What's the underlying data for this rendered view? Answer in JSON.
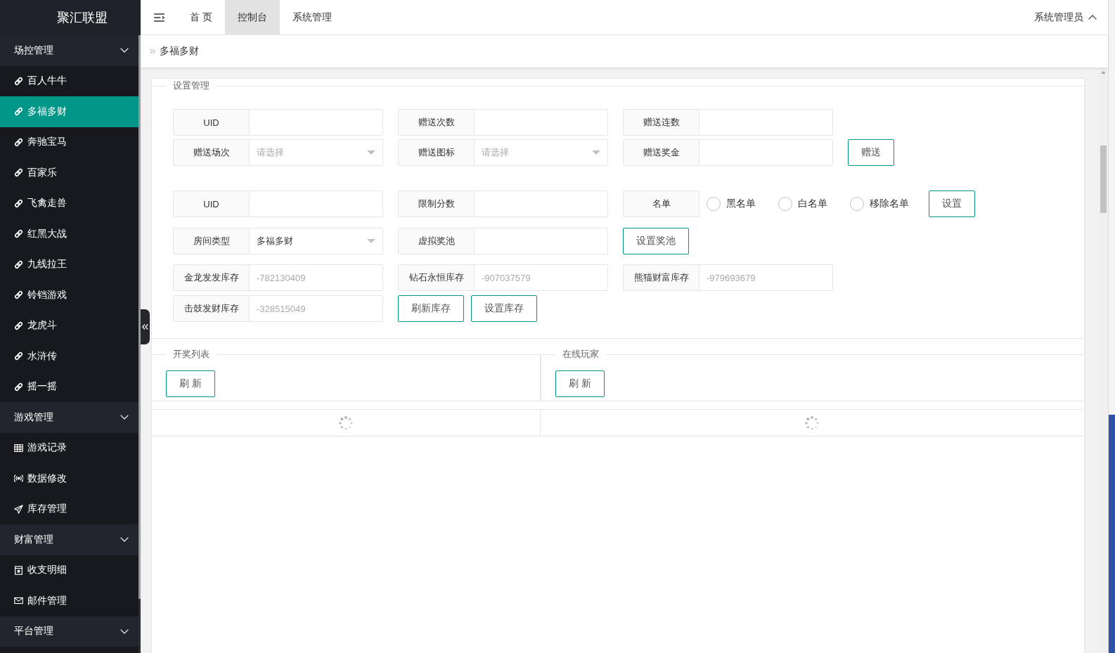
{
  "sidebar": {
    "logo": "聚汇联盟",
    "groups": [
      {
        "title": "场控管理",
        "items": [
          {
            "label": "百人牛牛",
            "kind": "link",
            "selected": false
          },
          {
            "label": "多福多财",
            "kind": "link",
            "selected": true
          },
          {
            "label": "奔驰宝马",
            "kind": "link",
            "selected": false
          },
          {
            "label": "百家乐",
            "kind": "link",
            "selected": false
          },
          {
            "label": "飞禽走兽",
            "kind": "link",
            "selected": false
          },
          {
            "label": "红黑大战",
            "kind": "link",
            "selected": false
          },
          {
            "label": "九线拉王",
            "kind": "link",
            "selected": false
          },
          {
            "label": "铃铛游戏",
            "kind": "link",
            "selected": false
          },
          {
            "label": "龙虎斗",
            "kind": "link",
            "selected": false
          },
          {
            "label": "水浒传",
            "kind": "link",
            "selected": false
          },
          {
            "label": "摇一摇",
            "kind": "link",
            "selected": false
          }
        ]
      },
      {
        "title": "游戏管理",
        "items": [
          {
            "label": "游戏记录",
            "kind": "grid",
            "selected": false
          },
          {
            "label": "数据修改",
            "kind": "signal",
            "selected": false
          },
          {
            "label": "库存管理",
            "kind": "send",
            "selected": false
          }
        ]
      },
      {
        "title": "财富管理",
        "items": [
          {
            "label": "收支明细",
            "kind": "ledger",
            "selected": false
          },
          {
            "label": "邮件管理",
            "kind": "mail",
            "selected": false
          }
        ]
      },
      {
        "title": "平台管理"
      }
    ]
  },
  "topbar": {
    "tabs": [
      {
        "label": "首 页",
        "selected": false
      },
      {
        "label": "控制台",
        "selected": true
      },
      {
        "label": "系统管理",
        "selected": false
      }
    ],
    "user": "系统管理员"
  },
  "breadcrumb": "多福多财",
  "settings": {
    "legend": "设置管理",
    "rows": [
      {
        "items": [
          {
            "kind": "input",
            "label": "UID"
          },
          {
            "kind": "input",
            "label": "赠送次数"
          },
          {
            "kind": "input",
            "label": "赠送连数"
          }
        ]
      },
      {
        "items": [
          {
            "kind": "select",
            "label": "赠送场次",
            "placeholder": "请选择"
          },
          {
            "kind": "select",
            "label": "赠送图标",
            "placeholder": "请选择"
          },
          {
            "kind": "input",
            "label": "赠送奖金"
          },
          {
            "kind": "button",
            "label": "赠送"
          }
        ]
      },
      {
        "items": [
          {
            "kind": "input",
            "label": "UID"
          },
          {
            "kind": "input",
            "label": "限制分数"
          },
          {
            "kind": "radio",
            "label": "名单",
            "options": [
              {
                "label": "黑名单",
                "selected": false
              },
              {
                "label": "白名单",
                "selected": false
              },
              {
                "label": "移除名单",
                "selected": false
              }
            ]
          },
          {
            "kind": "button",
            "label": "设置"
          }
        ]
      },
      {
        "items": [
          {
            "kind": "select",
            "label": "房间类型",
            "value": "多福多财"
          },
          {
            "kind": "input",
            "label": "虚拟奖池"
          },
          {
            "kind": "button",
            "label": "设置奖池"
          }
        ]
      },
      {
        "items": [
          {
            "kind": "input",
            "label": "金龙发发库存",
            "placeholder": "-782130409"
          },
          {
            "kind": "input",
            "label": "钻石永恒库存",
            "placeholder": "-907037579"
          },
          {
            "kind": "input",
            "label": "熊猫财富库存",
            "placeholder": "-979693679"
          }
        ]
      },
      {
        "items": [
          {
            "kind": "input",
            "label": "击鼓发财库存",
            "placeholder": "-328515049"
          },
          {
            "kind": "button",
            "label": "刷新库存"
          },
          {
            "kind": "button",
            "label": "设置库存"
          }
        ]
      }
    ]
  },
  "panels": [
    {
      "legend": "开奖列表",
      "button": "刷 新",
      "loading": true
    },
    {
      "legend": "在线玩家",
      "button": "刷 新",
      "loading": true
    }
  ]
}
